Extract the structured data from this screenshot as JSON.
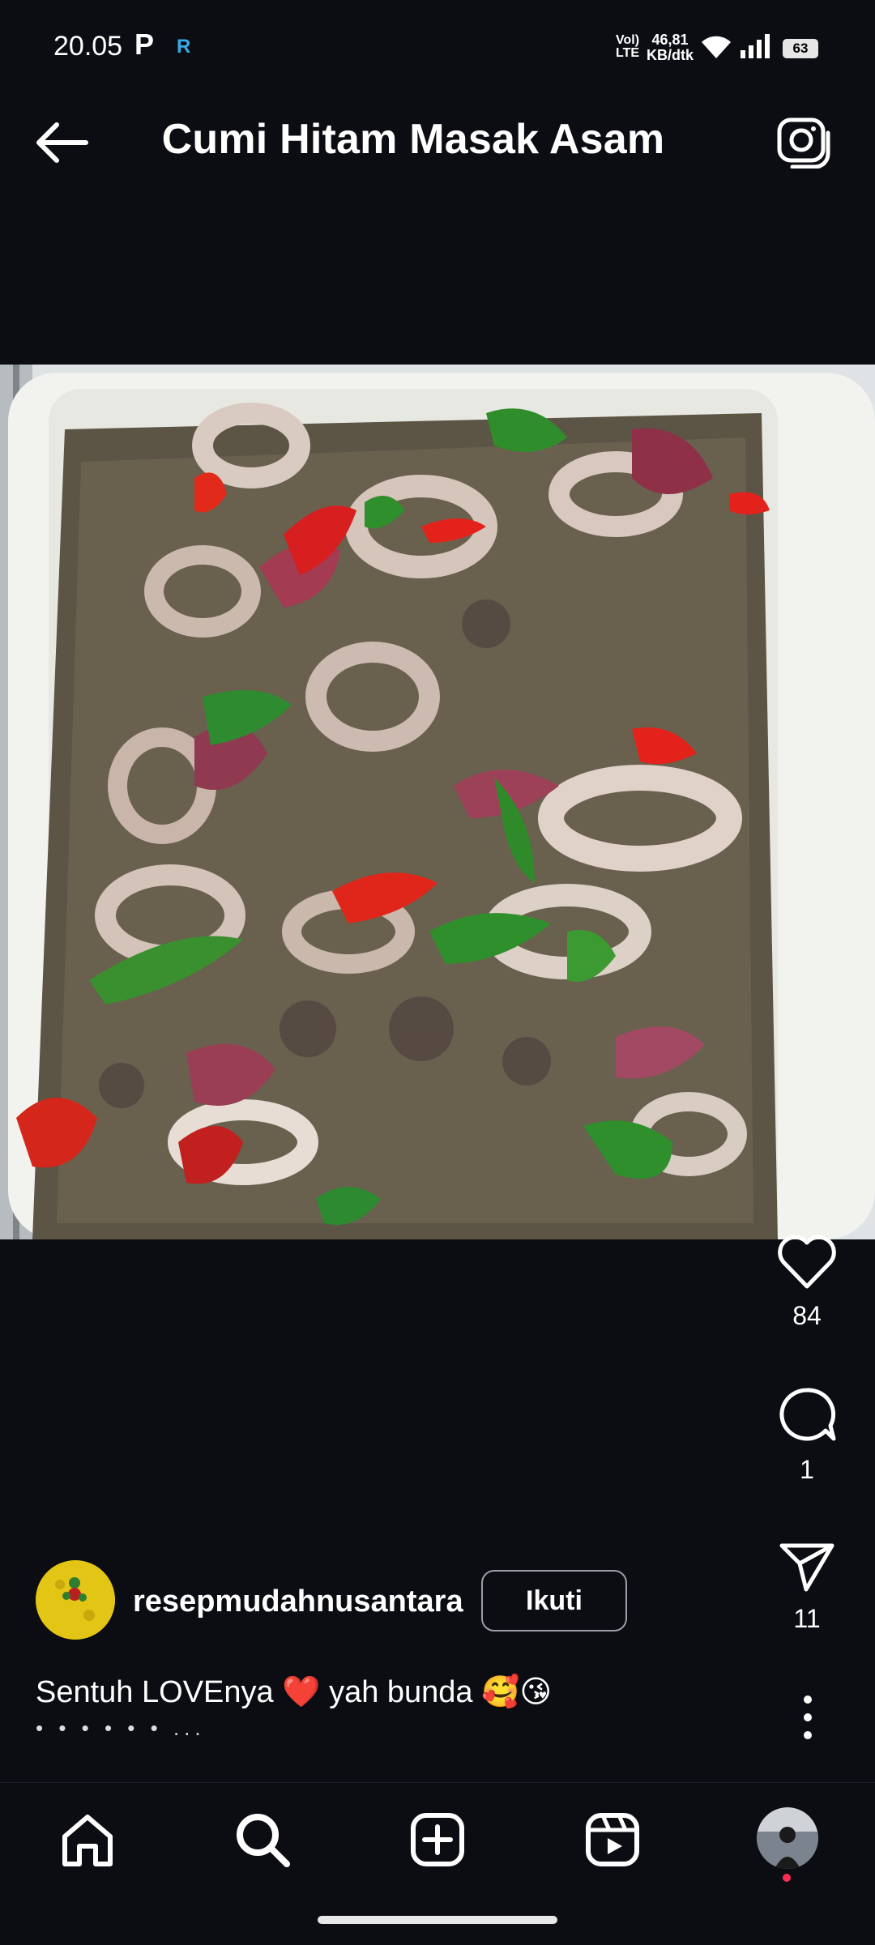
{
  "status_bar": {
    "time": "20.05",
    "carrier_glyph": "P",
    "extra_glyph": "R",
    "network_top": "Vol)",
    "network_bottom": "LTE",
    "speed_value": "46,81",
    "speed_unit": "KB/dtk",
    "battery": "63"
  },
  "header": {
    "title": "Cumi Hitam Masak Asam",
    "back_icon": "arrow-left-icon",
    "camera_icon": "camera-icon"
  },
  "post": {
    "image_alt": "stir-fried squid with red and green chilies in a white dish",
    "likes": "84",
    "comments": "1",
    "shares": "11",
    "author": "resepmudahnusantara",
    "follow_label": "Ikuti",
    "caption": "Sentuh LOVEnya ❤️ yah bunda 🥰😘",
    "caption_more": "• • • • • • ..."
  },
  "nav": {
    "items": [
      "home-icon",
      "search-icon",
      "create-icon",
      "reels-icon",
      "profile-avatar"
    ]
  },
  "colors": {
    "background": "#0b0d12",
    "text": "#ffffff",
    "accent_dot": "#ff2d55"
  }
}
